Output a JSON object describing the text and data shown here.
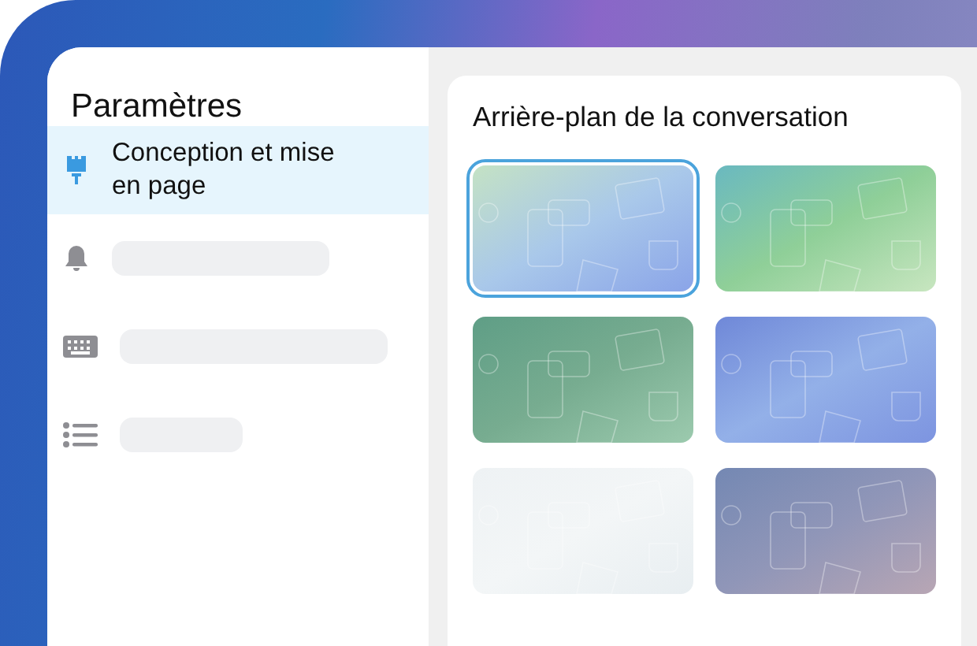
{
  "sidebar": {
    "title": "Paramètres",
    "items": [
      {
        "kind": "label",
        "label": "Conception et mise en page",
        "selected": true
      },
      {
        "kind": "skeleton",
        "selected": false
      },
      {
        "kind": "skeleton",
        "selected": false
      },
      {
        "kind": "skeleton",
        "selected": false
      }
    ]
  },
  "panel": {
    "title": "Arrière-plan de la conversation",
    "wallpapers": [
      {
        "kind": "picture",
        "selected": true
      },
      {
        "kind": "picture",
        "selected": false
      },
      {
        "kind": "picture",
        "selected": false
      },
      {
        "kind": "picture",
        "selected": false
      },
      {
        "kind": "picture",
        "selected": false
      },
      {
        "kind": "picture",
        "selected": false
      }
    ]
  }
}
